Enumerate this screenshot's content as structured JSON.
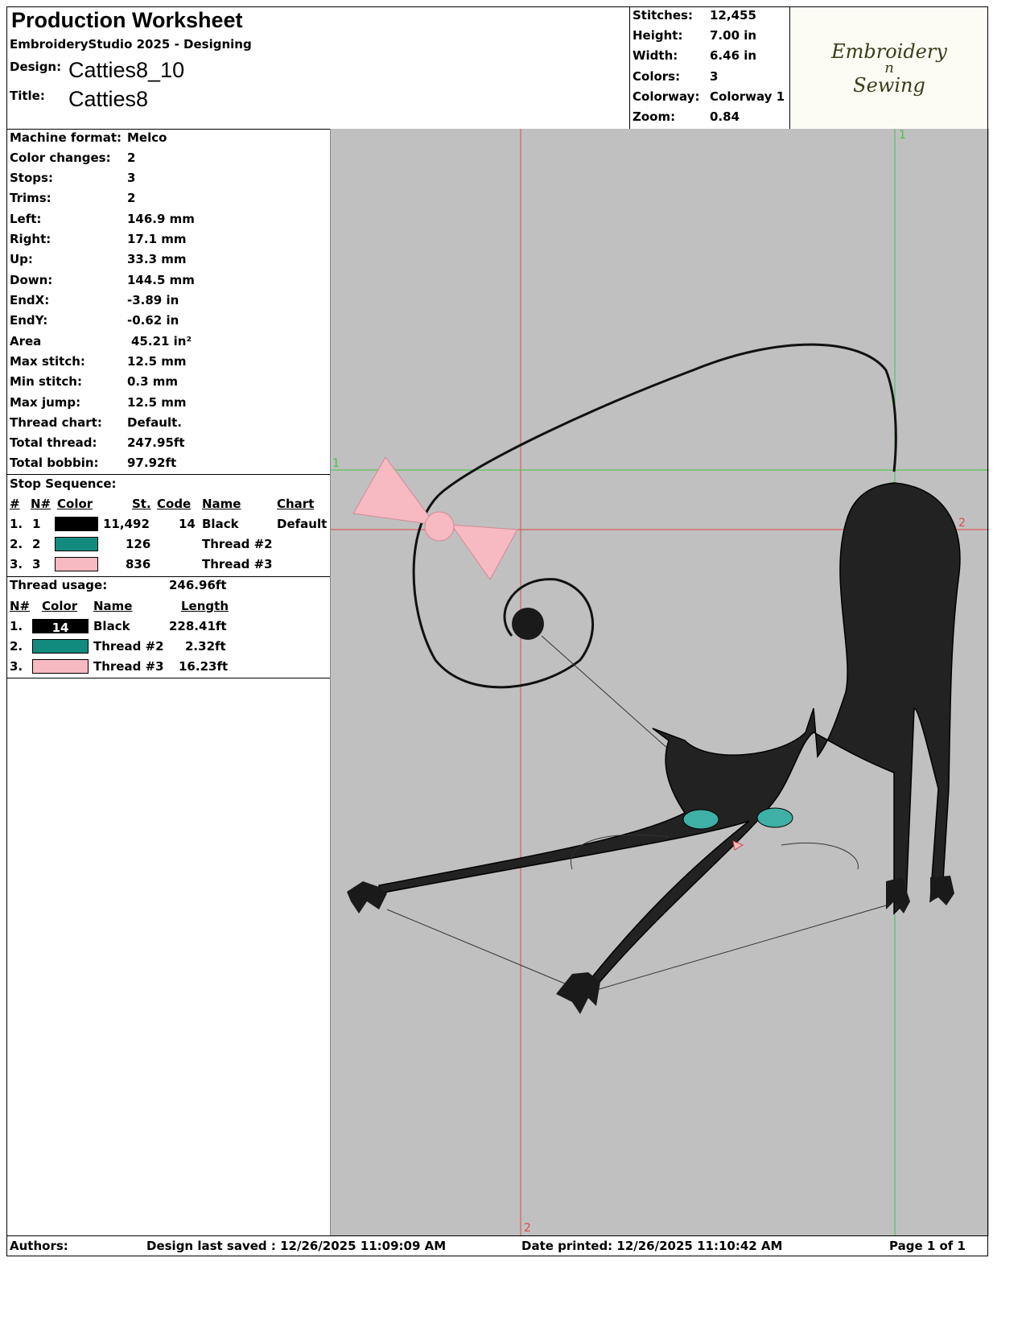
{
  "header": {
    "title": "Production Worksheet",
    "app": "EmbroideryStudio 2025 - Designing",
    "design_label": "Design:",
    "design_value": "Catties8_10",
    "title_label": "Title:",
    "title_value": "Catties8"
  },
  "summary": [
    {
      "label": "Stitches:",
      "value": "12,455"
    },
    {
      "label": "Height:",
      "value": "7.00 in"
    },
    {
      "label": "Width:",
      "value": "6.46 in"
    },
    {
      "label": "Colors:",
      "value": "3"
    },
    {
      "label": "Colorway:",
      "value": "Colorway 1"
    },
    {
      "label": "Zoom:",
      "value": "0.84"
    }
  ],
  "logo": {
    "line1": "Embroidery",
    "line2": "n",
    "line3": "Sewing"
  },
  "machine_info": [
    {
      "label": "Machine format:",
      "value": "Melco"
    },
    {
      "label": "Color changes:",
      "value": "2"
    },
    {
      "label": "Stops:",
      "value": "3"
    },
    {
      "label": "Trims:",
      "value": "2"
    },
    {
      "label": "Left:",
      "value": "146.9 mm"
    },
    {
      "label": "Right:",
      "value": "17.1 mm"
    },
    {
      "label": "Up:",
      "value": "33.3 mm"
    },
    {
      "label": "Down:",
      "value": "144.5 mm"
    },
    {
      "label": "EndX:",
      "value": "-3.89 in"
    },
    {
      "label": "EndY:",
      "value": "-0.62 in"
    },
    {
      "label": "Area",
      "value": "45.21 in²"
    },
    {
      "label": "Max stitch:",
      "value": "12.5 mm"
    },
    {
      "label": "Min stitch:",
      "value": "0.3 mm"
    },
    {
      "label": "Max jump:",
      "value": "12.5 mm"
    },
    {
      "label": "Thread chart:",
      "value": "Default."
    },
    {
      "label": "Total thread:",
      "value": "247.95ft"
    },
    {
      "label": "Total bobbin:",
      "value": "97.92ft"
    }
  ],
  "stop_sequence": {
    "heading": "Stop Sequence:",
    "columns": {
      "num": "#",
      "n": "N#",
      "color": "Color",
      "st": "St.",
      "code": "Code",
      "name": "Name",
      "chart": "Chart"
    },
    "rows": [
      {
        "num": "1.",
        "n": "1",
        "color": "#000000",
        "st": "11,492",
        "code": "14",
        "name": "Black",
        "chart": "Default"
      },
      {
        "num": "2.",
        "n": "2",
        "color": "#138a7e",
        "st": "126",
        "code": "",
        "name": "Thread #2",
        "chart": ""
      },
      {
        "num": "3.",
        "n": "3",
        "color": "#f7b9c2",
        "st": "836",
        "code": "",
        "name": "Thread #3",
        "chart": ""
      }
    ]
  },
  "thread_usage": {
    "heading": "Thread usage:",
    "total": "246.96ft",
    "columns": {
      "n": "N#",
      "color": "Color",
      "name": "Name",
      "length": "Length"
    },
    "rows": [
      {
        "n": "1.",
        "color": "#000000",
        "code": "14",
        "name": "Black",
        "length": "228.41ft"
      },
      {
        "n": "2.",
        "color": "#138a7e",
        "code": "",
        "name": "Thread #2",
        "length": "2.32ft"
      },
      {
        "n": "3.",
        "color": "#f7b9c2",
        "code": "",
        "name": "Thread #3",
        "length": "16.23ft"
      }
    ]
  },
  "guides": {
    "v_red": "2",
    "v_green": "1",
    "h_green": "1",
    "h_red": "2",
    "v_red_bottom": "2"
  },
  "footer": {
    "authors": "Authors:",
    "saved": "Design last saved : 12/26/2025 11:09:09 AM",
    "printed": "Date printed: 12/26/2025 11:10:42 AM",
    "page": "Page 1 of 1"
  },
  "colors": {
    "canvas": "#c0c0c0",
    "guide_red": "#e04848",
    "guide_green": "#3cc83c"
  }
}
